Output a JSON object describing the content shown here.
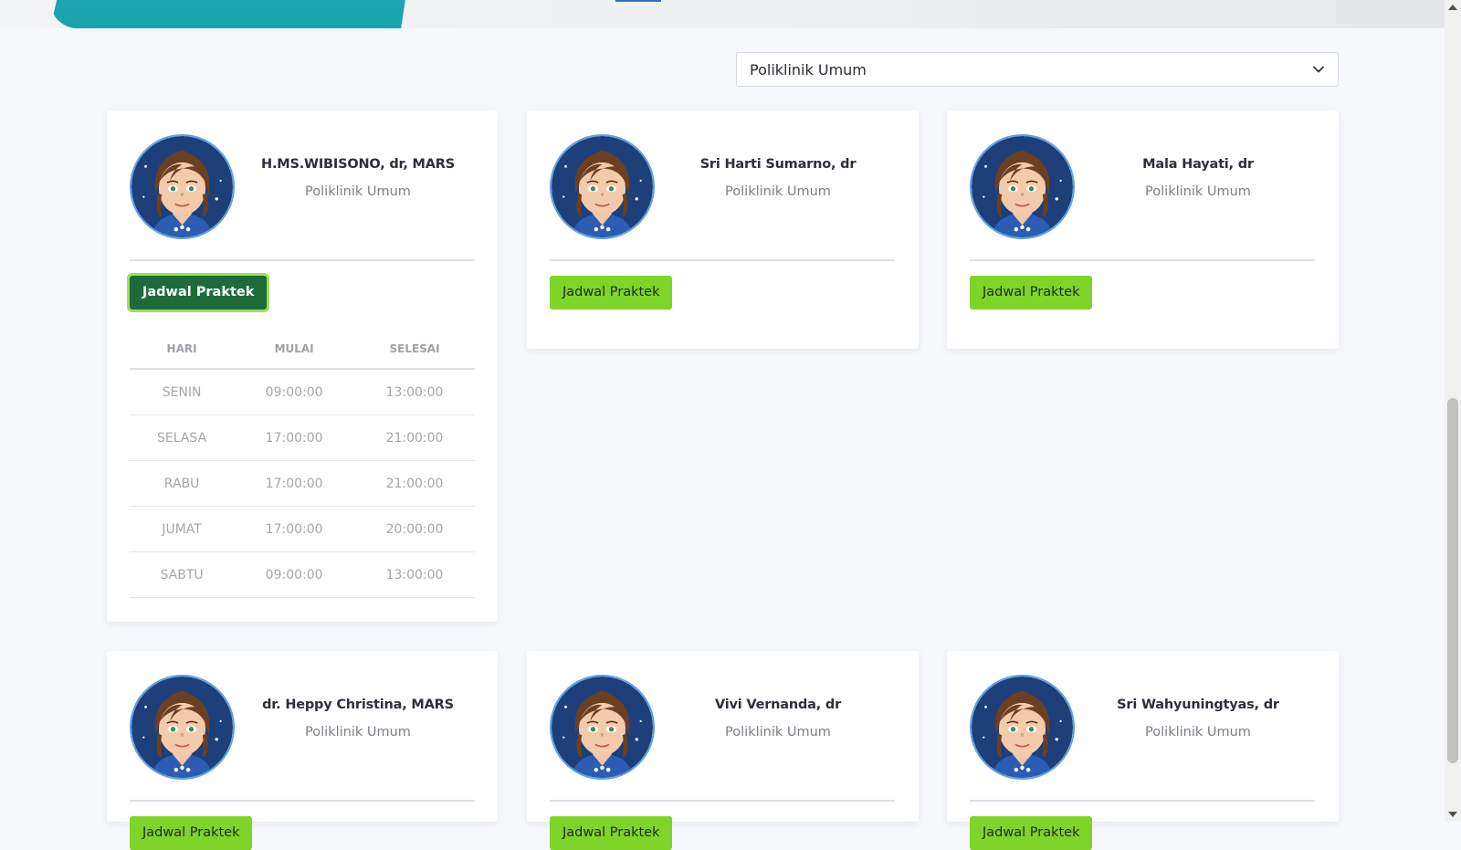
{
  "filter": {
    "selected": "Poliklinik Umum"
  },
  "button_label": "Jadwal Praktek",
  "schedule_headers": [
    "HARI",
    "MULAI",
    "SELESAI"
  ],
  "doctors": [
    {
      "name": "H.MS.WIBISONO, dr, MARS",
      "poli": "Poliklinik Umum",
      "schedule": [
        [
          "SENIN",
          "09:00:00",
          "13:00:00"
        ],
        [
          "SELASA",
          "17:00:00",
          "21:00:00"
        ],
        [
          "RABU",
          "17:00:00",
          "21:00:00"
        ],
        [
          "JUMAT",
          "17:00:00",
          "20:00:00"
        ],
        [
          "SABTU",
          "09:00:00",
          "13:00:00"
        ]
      ]
    },
    {
      "name": "Sri Harti Sumarno, dr",
      "poli": "Poliklinik Umum"
    },
    {
      "name": "Mala Hayati, dr",
      "poli": "Poliklinik Umum"
    },
    {
      "name": "dr. Heppy Christina, MARS",
      "poli": "Poliklinik Umum"
    },
    {
      "name": "Vivi Vernanda, dr",
      "poli": "Poliklinik Umum"
    },
    {
      "name": "Sri Wahyuningtyas, dr",
      "poli": "Poliklinik Umum"
    }
  ],
  "colors": {
    "button_green": "#7fd42a",
    "button_active": "#1e6b3a",
    "avatar_ring": "#5fa0e6",
    "banner_teal": "#17a2ae"
  }
}
